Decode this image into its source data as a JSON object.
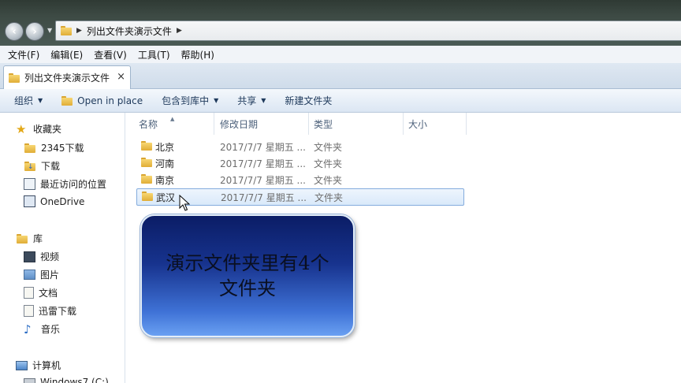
{
  "address_bar": {
    "crumb": "列出文件夹演示文件"
  },
  "menu": [
    "文件(F)",
    "编辑(E)",
    "查看(V)",
    "工具(T)",
    "帮助(H)"
  ],
  "tab": {
    "label": "列出文件夹演示文件",
    "close": "×"
  },
  "toolbar": {
    "organize": "组织",
    "open_in_place": "Open in place",
    "include_in_library": "包含到库中",
    "share": "共享",
    "new_folder": "新建文件夹"
  },
  "nav": {
    "favorites": "收藏夹",
    "fav_items": [
      "2345下载",
      "下载",
      "最近访问的位置",
      "OneDrive"
    ],
    "libraries": "库",
    "lib_items": [
      "视频",
      "图片",
      "文档",
      "迅雷下载",
      "音乐"
    ],
    "computer": "计算机",
    "drive": "Windows7 (C:)"
  },
  "columns": {
    "name": "名称",
    "date": "修改日期",
    "type": "类型",
    "size": "大小"
  },
  "files": [
    {
      "name": "北京",
      "date": "2017/7/7 星期五 ...",
      "type": "文件夹"
    },
    {
      "name": "河南",
      "date": "2017/7/7 星期五 ...",
      "type": "文件夹"
    },
    {
      "name": "南京",
      "date": "2017/7/7 星期五 ...",
      "type": "文件夹"
    },
    {
      "name": "武汉",
      "date": "2017/7/7 星期五 ...",
      "type": "文件夹"
    }
  ],
  "callout": {
    "text": "演示文件夹里有4个文件夹"
  },
  "colors": {
    "accent": "#3f72d6",
    "selection": "#d9e9fa",
    "folder": "#e0ad36"
  }
}
